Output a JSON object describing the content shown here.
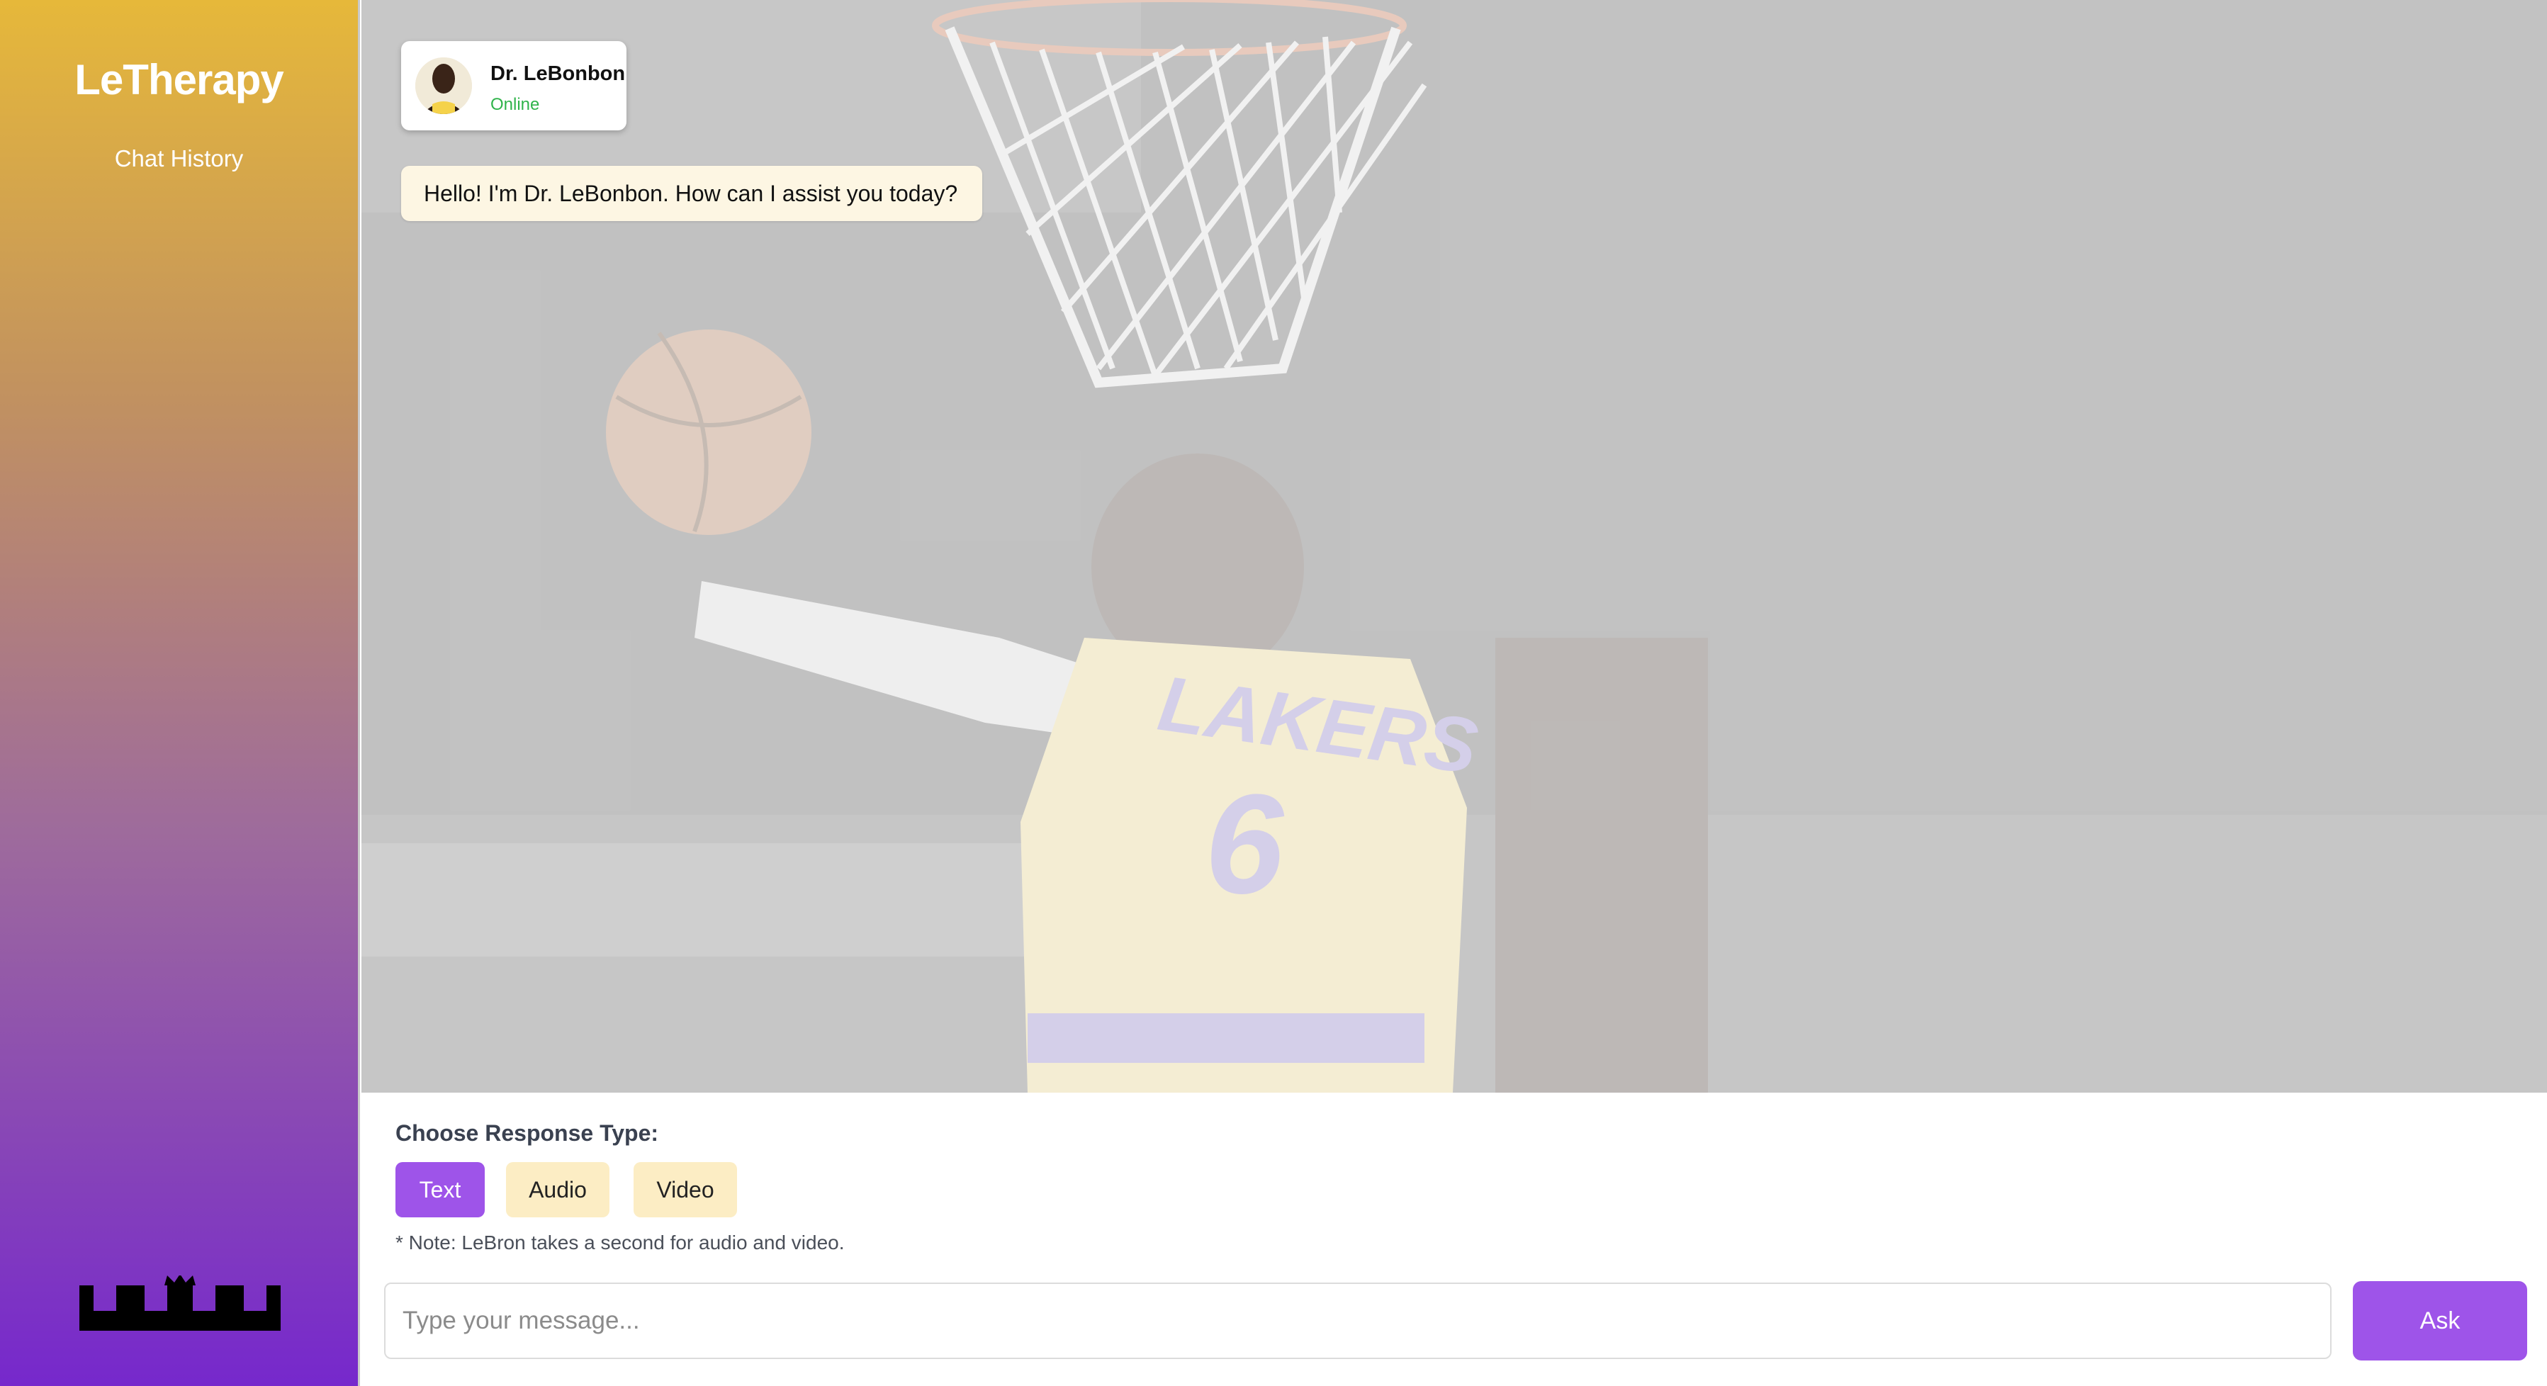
{
  "sidebar": {
    "brand": "LeTherapy",
    "chat_history": "Chat History"
  },
  "chat": {
    "bot_name": "Dr. LeBonbon",
    "bot_status": "Online",
    "messages": [
      {
        "sender": "bot",
        "text": "Hello! I'm Dr. LeBonbon. How can I assist you today?"
      }
    ]
  },
  "response_type": {
    "heading": "Choose Response Type:",
    "options": [
      "Text",
      "Audio",
      "Video"
    ],
    "selected": "Text",
    "note": "* Note: LeBron takes a second for audio and video."
  },
  "composer": {
    "placeholder": "Type your message...",
    "value": "",
    "ask_label": "Ask"
  },
  "colors": {
    "accent": "#9e54e9",
    "option_bg": "#fcedc4",
    "status_online": "#2fb34a",
    "sidebar_top": "#e6b83a",
    "sidebar_bottom": "#7628cc",
    "jersey_yellow": "#fde68a",
    "jersey_purple": "#8b7ad6"
  }
}
